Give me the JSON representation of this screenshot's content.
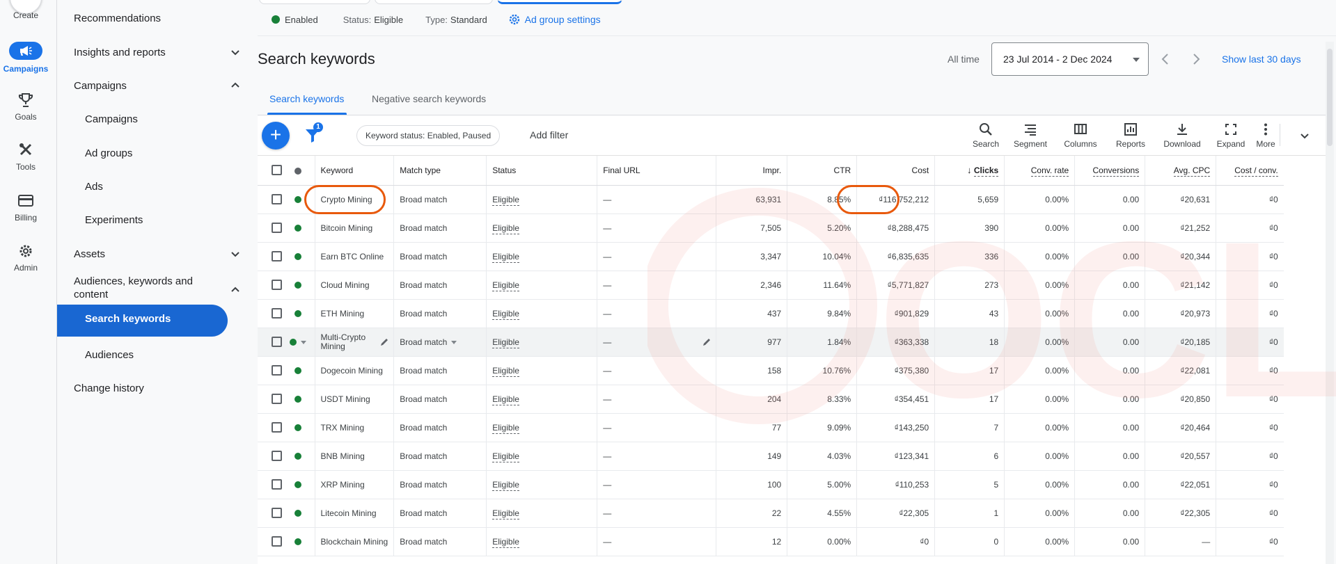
{
  "rail": {
    "create_label": "Create",
    "items": [
      {
        "label": "Campaigns",
        "icon": "megaphone-icon"
      },
      {
        "label": "Goals",
        "icon": "trophy-icon"
      },
      {
        "label": "Tools",
        "icon": "tools-icon"
      },
      {
        "label": "Billing",
        "icon": "credit-card-icon"
      },
      {
        "label": "Admin",
        "icon": "gear-icon"
      }
    ]
  },
  "nav": {
    "recommendations": "Recommendations",
    "insights": "Insights and reports",
    "campaigns_group": "Campaigns",
    "campaigns": "Campaigns",
    "ad_groups": "Ad groups",
    "ads": "Ads",
    "experiments": "Experiments",
    "assets": "Assets",
    "audiences_group": "Audiences, keywords and content",
    "search_keywords": "Search keywords",
    "audiences": "Audiences",
    "change_history": "Change history"
  },
  "topbar": {
    "enabled": "Enabled",
    "status_key": "Status:",
    "status_value": "Eligible",
    "type_key": "Type:",
    "type_value": "Standard",
    "settings": "Ad group settings"
  },
  "page": {
    "title": "Search keywords",
    "range_label": "All time",
    "range_value": "23 Jul 2014 - 2 Dec 2024",
    "show_last": "Show last 30 days"
  },
  "tabs": [
    "Search keywords",
    "Negative search keywords"
  ],
  "toolbar": {
    "filter_count": "1",
    "chip": "Keyword status: Enabled, Paused",
    "add_filter": "Add filter",
    "tools": [
      "Search",
      "Segment",
      "Columns",
      "Reports",
      "Download",
      "Expand",
      "More"
    ]
  },
  "table": {
    "headers": {
      "keyword": "Keyword",
      "match_type": "Match type",
      "status": "Status",
      "final_url": "Final URL",
      "impr": "Impr.",
      "ctr": "CTR",
      "cost": "Cost",
      "clicks": "Clicks",
      "conv_rate": "Conv. rate",
      "conversions": "Conversions",
      "avg_cpc": "Avg. CPC",
      "cost_conv": "Cost / conv."
    },
    "rows": [
      {
        "keyword": "Crypto Mining",
        "match": "Broad match",
        "status": "Eligible",
        "url": "—",
        "impr": "63,931",
        "ctr": "8.85%",
        "cost": "₫116,752,212",
        "clicks": "5,659",
        "conv_rate": "0.00%",
        "conversions": "0.00",
        "avg_cpc": "₫20,631",
        "cost_conv": "₫0"
      },
      {
        "keyword": "Bitcoin Mining",
        "match": "Broad match",
        "status": "Eligible",
        "url": "—",
        "impr": "7,505",
        "ctr": "5.20%",
        "cost": "₫8,288,475",
        "clicks": "390",
        "conv_rate": "0.00%",
        "conversions": "0.00",
        "avg_cpc": "₫21,252",
        "cost_conv": "₫0"
      },
      {
        "keyword": "Earn BTC Online",
        "match": "Broad match",
        "status": "Eligible",
        "url": "—",
        "impr": "3,347",
        "ctr": "10.04%",
        "cost": "₫6,835,635",
        "clicks": "336",
        "conv_rate": "0.00%",
        "conversions": "0.00",
        "avg_cpc": "₫20,344",
        "cost_conv": "₫0"
      },
      {
        "keyword": "Cloud Mining",
        "match": "Broad match",
        "status": "Eligible",
        "url": "—",
        "impr": "2,346",
        "ctr": "11.64%",
        "cost": "₫5,771,827",
        "clicks": "273",
        "conv_rate": "0.00%",
        "conversions": "0.00",
        "avg_cpc": "₫21,142",
        "cost_conv": "₫0"
      },
      {
        "keyword": "ETH Mining",
        "match": "Broad match",
        "status": "Eligible",
        "url": "—",
        "impr": "437",
        "ctr": "9.84%",
        "cost": "₫901,829",
        "clicks": "43",
        "conv_rate": "0.00%",
        "conversions": "0.00",
        "avg_cpc": "₫20,973",
        "cost_conv": "₫0"
      },
      {
        "keyword": "Multi-Crypto Mining",
        "match": "Broad match",
        "status": "Eligible",
        "url": "—",
        "impr": "977",
        "ctr": "1.84%",
        "cost": "₫363,338",
        "clicks": "18",
        "conv_rate": "0.00%",
        "conversions": "0.00",
        "avg_cpc": "₫20,185",
        "cost_conv": "₫0"
      },
      {
        "keyword": "Dogecoin Mining",
        "match": "Broad match",
        "status": "Eligible",
        "url": "—",
        "impr": "158",
        "ctr": "10.76%",
        "cost": "₫375,380",
        "clicks": "17",
        "conv_rate": "0.00%",
        "conversions": "0.00",
        "avg_cpc": "₫22,081",
        "cost_conv": "₫0"
      },
      {
        "keyword": "USDT Mining",
        "match": "Broad match",
        "status": "Eligible",
        "url": "—",
        "impr": "204",
        "ctr": "8.33%",
        "cost": "₫354,451",
        "clicks": "17",
        "conv_rate": "0.00%",
        "conversions": "0.00",
        "avg_cpc": "₫20,850",
        "cost_conv": "₫0"
      },
      {
        "keyword": "TRX Mining",
        "match": "Broad match",
        "status": "Eligible",
        "url": "—",
        "impr": "77",
        "ctr": "9.09%",
        "cost": "₫143,250",
        "clicks": "7",
        "conv_rate": "0.00%",
        "conversions": "0.00",
        "avg_cpc": "₫20,464",
        "cost_conv": "₫0"
      },
      {
        "keyword": "BNB Mining",
        "match": "Broad match",
        "status": "Eligible",
        "url": "—",
        "impr": "149",
        "ctr": "4.03%",
        "cost": "₫123,341",
        "clicks": "6",
        "conv_rate": "0.00%",
        "conversions": "0.00",
        "avg_cpc": "₫20,557",
        "cost_conv": "₫0"
      },
      {
        "keyword": "XRP Mining",
        "match": "Broad match",
        "status": "Eligible",
        "url": "—",
        "impr": "100",
        "ctr": "5.00%",
        "cost": "₫110,253",
        "clicks": "5",
        "conv_rate": "0.00%",
        "conversions": "0.00",
        "avg_cpc": "₫22,051",
        "cost_conv": "₫0"
      },
      {
        "keyword": "Litecoin Mining",
        "match": "Broad match",
        "status": "Eligible",
        "url": "—",
        "impr": "22",
        "ctr": "4.55%",
        "cost": "₫22,305",
        "clicks": "1",
        "conv_rate": "0.00%",
        "conversions": "0.00",
        "avg_cpc": "₫22,305",
        "cost_conv": "₫0"
      },
      {
        "keyword": "Blockchain Mining",
        "match": "Broad match",
        "status": "Eligible",
        "url": "—",
        "impr": "12",
        "ctr": "0.00%",
        "cost": "₫0",
        "clicks": "0",
        "conv_rate": "0.00%",
        "conversions": "0.00",
        "avg_cpc": "—",
        "cost_conv": "₫0"
      }
    ]
  },
  "colors": {
    "accent": "#1a73e8",
    "status_green": "#188038",
    "annotation": "#e8590c",
    "watermark": "#f28b82"
  },
  "watermark_text": "OCLUA"
}
